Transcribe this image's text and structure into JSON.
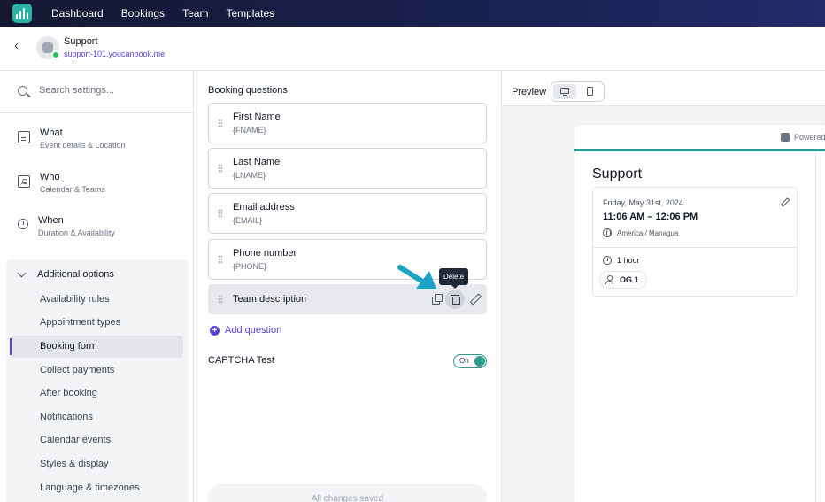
{
  "nav": {
    "items": [
      "Dashboard",
      "Bookings",
      "Team",
      "Templates"
    ]
  },
  "header": {
    "title": "Support",
    "url": "support-101.youcanbook.me"
  },
  "sidebar": {
    "search_placeholder": "Search settings...",
    "sections": [
      {
        "title": "What",
        "subtitle": "Event details & Location",
        "icon": "document-icon"
      },
      {
        "title": "Who",
        "subtitle": "Calendar & Teams",
        "icon": "team-icon"
      },
      {
        "title": "When",
        "subtitle": "Duration & Availability",
        "icon": "watch-icon"
      }
    ],
    "options_title": "Additional options",
    "options": [
      "Availability rules",
      "Appointment types",
      "Booking form",
      "Collect payments",
      "After booking",
      "Notifications",
      "Calendar events",
      "Styles & display",
      "Language & timezones"
    ],
    "active_option": "Booking form"
  },
  "booking_questions": {
    "title": "Booking questions",
    "questions": [
      {
        "label": "First Name",
        "variable": "{FNAME}"
      },
      {
        "label": "Last Name",
        "variable": "{LNAME}"
      },
      {
        "label": "Email address",
        "variable": "{EMAIL}"
      },
      {
        "label": "Phone number",
        "variable": "{PHONE}"
      },
      {
        "label": "Team description",
        "variable": ""
      }
    ],
    "tooltip": "Delete",
    "add_label": "Add question",
    "captcha_label": "CAPTCHA Test",
    "captcha_state": "On",
    "save_status": "All changes saved"
  },
  "preview": {
    "label": "Preview",
    "powered": "Powered",
    "title": "Support",
    "date": "Friday, May 31st, 2024",
    "time": "11:06 AM – 12:06 PM",
    "timezone": "America / Managua",
    "duration": "1 hour",
    "team": "OG 1"
  },
  "colors": {
    "accent": "#5b3fd6",
    "teal": "#2a9d8f",
    "nav_bg": "#1b2150",
    "arrow": "#1aa3c4"
  }
}
